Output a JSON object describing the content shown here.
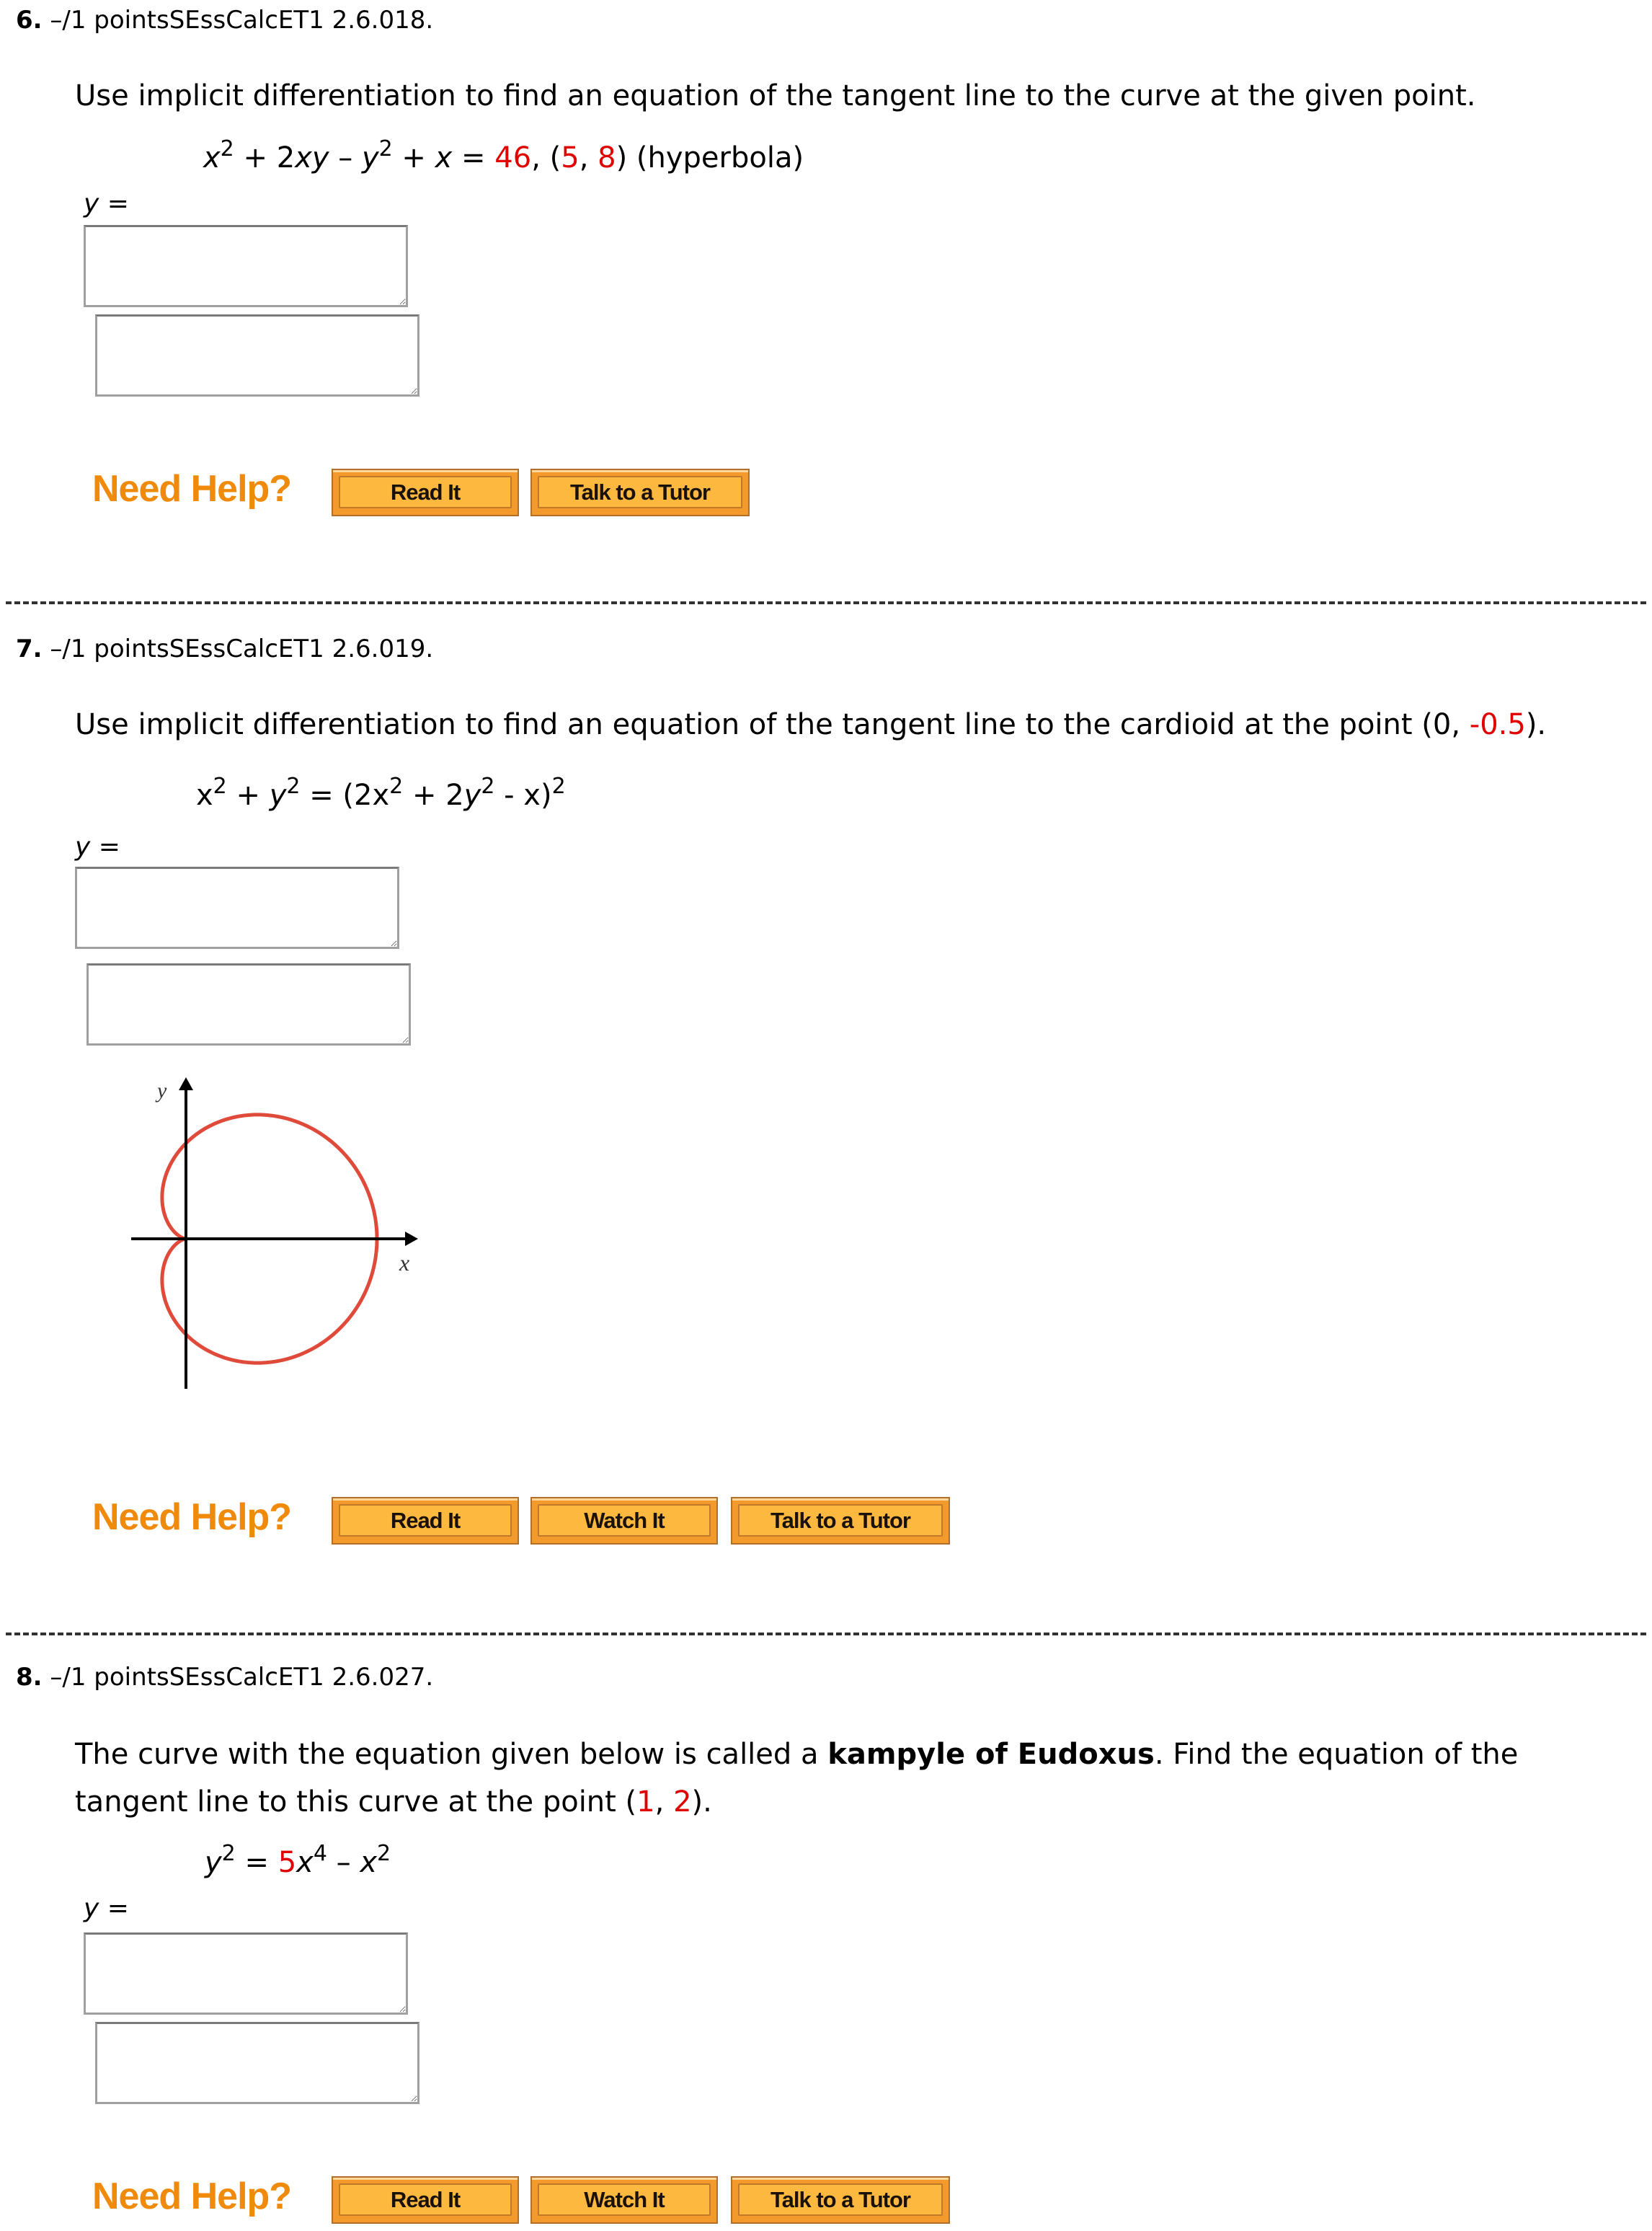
{
  "questions": [
    {
      "number": "6.",
      "points": "–/1 pointsSEssCalcET1 2.6.018.",
      "prompt": "Use implicit differentiation to find an equation of the tangent line to the curve at the given point.",
      "equation": {
        "parts": [
          "x",
          "2",
          " + 2",
          "xy",
          " – ",
          "y",
          "2",
          " + ",
          "x",
          " = ",
          "46",
          ",  (",
          "5",
          ", ",
          "8",
          ")   (hyperbola)"
        ]
      },
      "answer_label": "y",
      "answer_eq": " =",
      "answer_values": [
        "",
        ""
      ],
      "help_label": "Need Help?",
      "buttons": [
        "Read It",
        "Talk to a Tutor"
      ]
    },
    {
      "number": "7.",
      "points": "–/1 pointsSEssCalcET1 2.6.019.",
      "prompt_before": "Use implicit differentiation to find an equation of the tangent line to the cardioid at the point (0, ",
      "prompt_red": "-0.5",
      "prompt_after": ").",
      "equation": {
        "parts": [
          "x",
          "2",
          " + ",
          "y",
          "2",
          " = (2",
          "x",
          "2",
          " + 2",
          "y",
          "2",
          " - ",
          "x",
          ")",
          "2"
        ]
      },
      "answer_label": "y",
      "answer_eq": " =",
      "answer_values": [
        "",
        ""
      ],
      "figure": {
        "type": "cardioid",
        "x_axis_label": "x",
        "y_axis_label": "y",
        "curve_color": "#e04a3a"
      },
      "help_label": "Need Help?",
      "buttons": [
        "Read It",
        "Watch It",
        "Talk to a Tutor"
      ]
    },
    {
      "number": "8.",
      "points": "–/1 pointsSEssCalcET1 2.6.027.",
      "prompt_line1_before": "The curve with the equation given below is called a ",
      "prompt_line1_bold": "kampyle of Eudoxus",
      "prompt_line1_after": ". Find the equation of the",
      "prompt_line2_before": "tangent line to this curve at the point (",
      "prompt_line2_red1": "1",
      "prompt_line2_sep": ", ",
      "prompt_line2_red2": "2",
      "prompt_line2_after": ").",
      "equation": {
        "parts": [
          "y",
          "2",
          " = ",
          "5",
          "x",
          "4",
          " – ",
          "x",
          "2"
        ]
      },
      "answer_label": "y",
      "answer_eq": " =",
      "answer_values": [
        "",
        ""
      ],
      "help_label": "Need Help?",
      "buttons": [
        "Read It",
        "Watch It",
        "Talk to a Tutor"
      ]
    }
  ],
  "colors": {
    "highlight_red": "#e00000",
    "need_help_orange": "#f08a0b",
    "button_face": "#fdb83f",
    "button_frame": "#f39a2c"
  }
}
